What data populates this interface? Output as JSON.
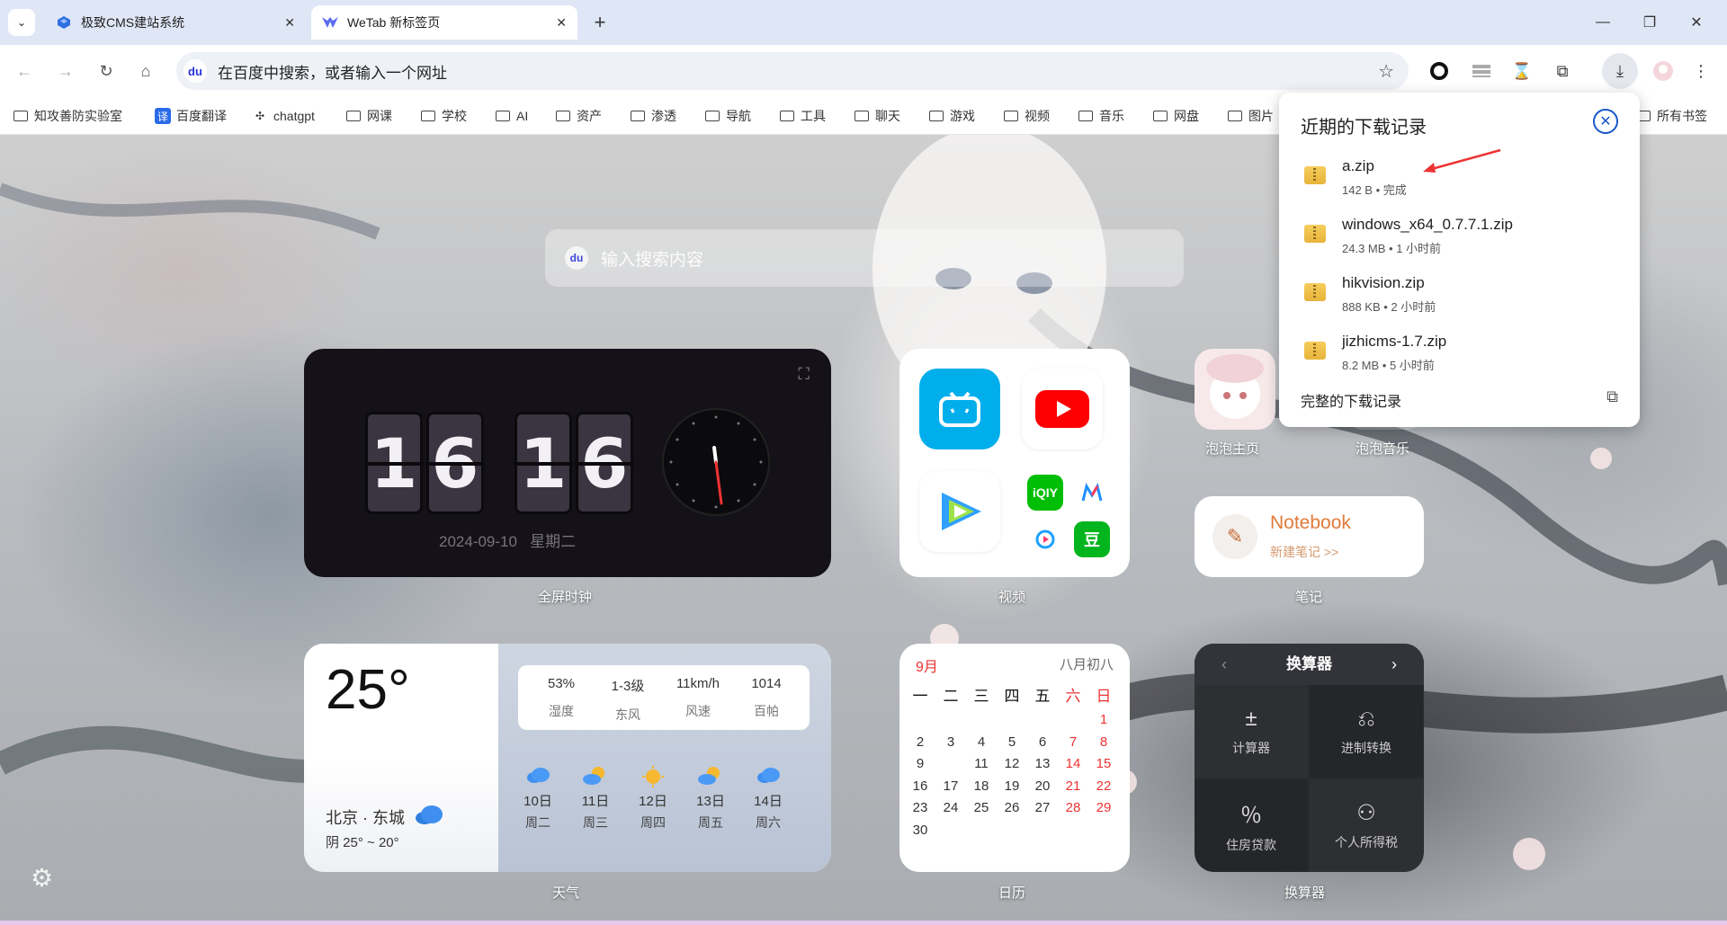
{
  "browser": {
    "tabs": [
      {
        "title": "极致CMS建站系统",
        "icon": "cube-icon"
      },
      {
        "title": "WeTab 新标签页",
        "icon": "wetab-icon"
      }
    ],
    "omnibox": {
      "text": "在百度中搜索，或者输入一个网址"
    },
    "bookmarks": [
      "知攻善防实验室",
      "百度翻译",
      "chatgpt",
      "网课",
      "学校",
      "AI",
      "资产",
      "渗透",
      "导航",
      "工具",
      "聊天",
      "游戏",
      "视频",
      "音乐",
      "网盘",
      "图片"
    ],
    "bookmarks_all": "所有书签"
  },
  "newtab": {
    "search_placeholder": "输入搜索内容",
    "clock": {
      "digits": [
        "1",
        "6",
        "1",
        "6"
      ],
      "date": "2024-09-10",
      "weekday": "星期二",
      "label": "全屏时钟"
    },
    "video_label": "视频",
    "apps": [
      {
        "name": "泡泡主页"
      },
      {
        "name": "泡泡音乐"
      }
    ],
    "notebook": {
      "title": "Notebook",
      "subtitle": "新建笔记 >>",
      "label": "笔记"
    },
    "weather": {
      "temp": "25°",
      "city": "北京 · 东城",
      "range": "阴 25° ~ 20°",
      "label": "天气",
      "stats": [
        {
          "value": "53%",
          "key": "湿度"
        },
        {
          "value": "1-3级",
          "key": "东风"
        },
        {
          "value": "11km/h",
          "key": "风速"
        },
        {
          "value": "1014",
          "key": "百帕"
        }
      ],
      "forecast": [
        {
          "date": "10日",
          "week": "周二",
          "icon": "cloud-icon"
        },
        {
          "date": "11日",
          "week": "周三",
          "icon": "partly-cloudy-icon"
        },
        {
          "date": "12日",
          "week": "周四",
          "icon": "sun-icon"
        },
        {
          "date": "13日",
          "week": "周五",
          "icon": "partly-cloudy-icon"
        },
        {
          "date": "14日",
          "week": "周六",
          "icon": "cloud-icon"
        }
      ]
    },
    "calendar": {
      "month": "9月",
      "lunar": "八月初八",
      "label": "日历",
      "headers": [
        "一",
        "二",
        "三",
        "四",
        "五",
        "六",
        "日"
      ],
      "first_col": 6,
      "days": 30,
      "today": 10
    },
    "converter": {
      "title": "换算器",
      "label": "换算器",
      "items": [
        {
          "name": "计算器",
          "icon": "calculator-icon"
        },
        {
          "name": "进制转换",
          "icon": "base-convert-icon"
        },
        {
          "name": "住房贷款",
          "icon": "percent-icon"
        },
        {
          "name": "个人所得税",
          "icon": "person-tax-icon"
        }
      ]
    }
  },
  "downloads": {
    "title": "近期的下载记录",
    "items": [
      {
        "name": "a.zip",
        "meta": "142 B • 完成"
      },
      {
        "name": "windows_x64_0.7.7.1.zip",
        "meta": "24.3 MB • 1 小时前"
      },
      {
        "name": "hikvision.zip",
        "meta": "888 KB • 2 小时前"
      },
      {
        "name": "jizhicms-1.7.zip",
        "meta": "8.2 MB • 5 小时前"
      }
    ],
    "full_history": "完整的下载记录"
  }
}
